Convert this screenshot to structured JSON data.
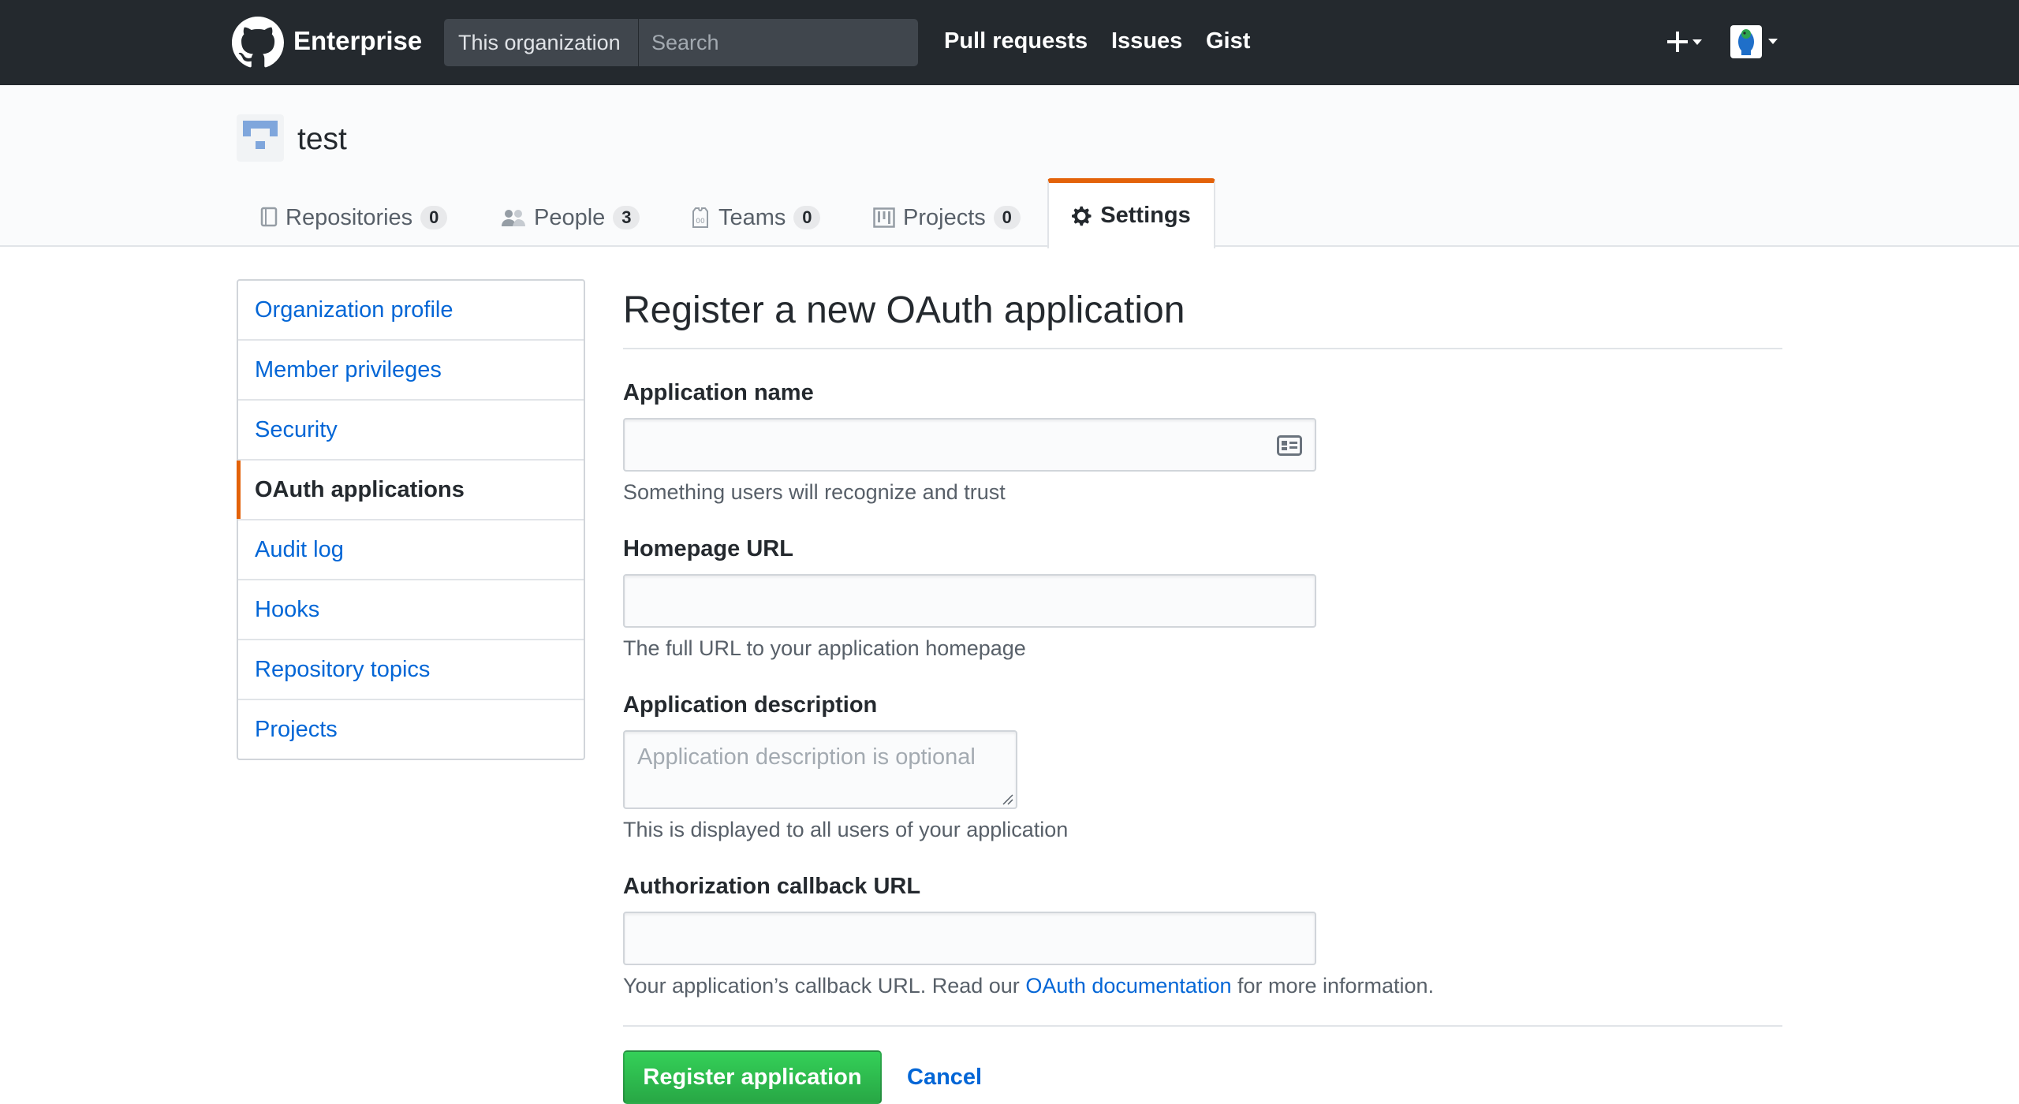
{
  "header": {
    "brand": "Enterprise",
    "scope": "This organization",
    "search_placeholder": "Search",
    "nav": [
      "Pull requests",
      "Issues",
      "Gist"
    ]
  },
  "org": {
    "name": "test",
    "tabs": [
      {
        "label": "Repositories",
        "count": "0",
        "icon": "repo-icon"
      },
      {
        "label": "People",
        "count": "3",
        "icon": "people-icon"
      },
      {
        "label": "Teams",
        "count": "0",
        "icon": "jersey-icon"
      },
      {
        "label": "Projects",
        "count": "0",
        "icon": "project-icon"
      }
    ],
    "selected_tab": {
      "label": "Settings",
      "icon": "gear-icon"
    }
  },
  "sidebar": {
    "items": [
      {
        "label": "Organization profile",
        "selected": false
      },
      {
        "label": "Member privileges",
        "selected": false
      },
      {
        "label": "Security",
        "selected": false
      },
      {
        "label": "OAuth applications",
        "selected": true
      },
      {
        "label": "Audit log",
        "selected": false
      },
      {
        "label": "Hooks",
        "selected": false
      },
      {
        "label": "Repository topics",
        "selected": false
      },
      {
        "label": "Projects",
        "selected": false
      }
    ]
  },
  "form": {
    "title": "Register a new OAuth application",
    "app_name": {
      "label": "Application name",
      "value": "",
      "note": "Something users will recognize and trust"
    },
    "homepage": {
      "label": "Homepage URL",
      "value": "",
      "note": "The full URL to your application homepage"
    },
    "description": {
      "label": "Application description",
      "placeholder": "Application description is optional",
      "note": "This is displayed to all users of your application"
    },
    "callback": {
      "label": "Authorization callback URL",
      "value": "",
      "note_prefix": "Your application’s callback URL. Read our ",
      "note_link": "OAuth documentation",
      "note_suffix": " for more information."
    },
    "submit": "Register application",
    "cancel": "Cancel"
  },
  "colors": {
    "header_bg": "#24292e",
    "link": "#0366d6",
    "accent": "#e36209",
    "primary_button": "#28a745"
  }
}
